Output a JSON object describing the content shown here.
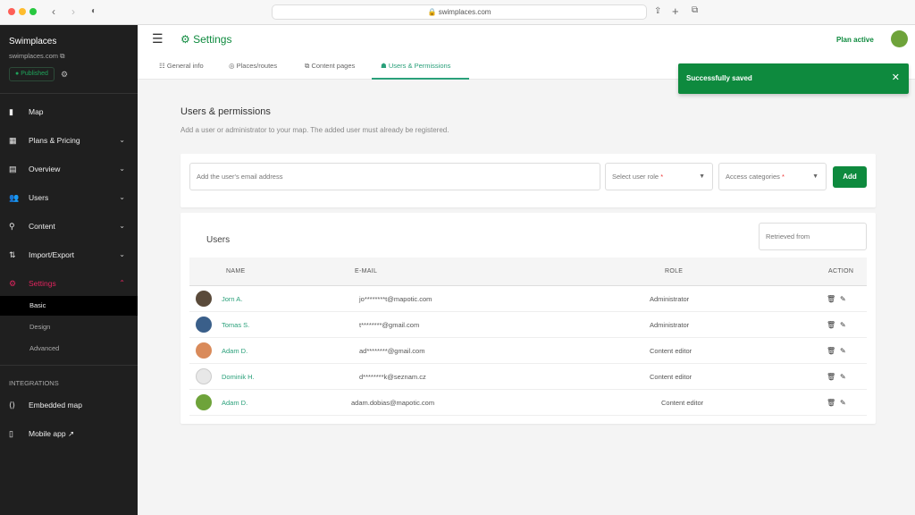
{
  "browser": {
    "url": "swimplaces.com"
  },
  "sidebar": {
    "project_name": "Swimplaces",
    "domain": "swimplaces.com",
    "status": "Published",
    "items": [
      {
        "label": "Map",
        "icon": "map-icon"
      },
      {
        "label": "Plans & Pricing",
        "icon": "grid-icon",
        "chevron": "down"
      },
      {
        "label": "Overview",
        "icon": "chart-icon",
        "chevron": "down"
      },
      {
        "label": "Users",
        "icon": "users-icon",
        "chevron": "down"
      },
      {
        "label": "Content",
        "icon": "pin-icon",
        "chevron": "down"
      },
      {
        "label": "Import/Export",
        "icon": "import-export-icon",
        "chevron": "down"
      },
      {
        "label": "Settings",
        "icon": "gear-icon",
        "chevron": "up",
        "active": true
      }
    ],
    "settings_sub": [
      "Basic",
      "Design",
      "Advanced"
    ],
    "integrations_heading": "INTEGRATIONS",
    "integrations": [
      {
        "label": "Embedded map",
        "icon": "embed-icon"
      },
      {
        "label": "Mobile app",
        "icon": "mobile-icon"
      }
    ]
  },
  "header": {
    "title": "Settings",
    "plan": "Plan active"
  },
  "tabs": [
    {
      "label": "General info",
      "icon": "sliders-icon"
    },
    {
      "label": "Places/routes",
      "icon": "pin-icon"
    },
    {
      "label": "Content pages",
      "icon": "copy-icon"
    },
    {
      "label": "Users & Permissions",
      "icon": "user-lock-icon",
      "active": true
    }
  ],
  "toast": {
    "message": "Successfully saved"
  },
  "section": {
    "title": "Users & permissions",
    "description": "Add a user or administrator to your map. The added user must already be registered."
  },
  "form": {
    "email_placeholder": "Add the user's email address",
    "role_placeholder": "Select user role",
    "categories_placeholder": "Access categories",
    "required_mark": "*",
    "add_label": "Add"
  },
  "users": {
    "title": "Users",
    "retrieved_placeholder": "Retrieved from",
    "columns": [
      "NAME",
      "E-MAIL",
      "ROLE",
      "ACTION"
    ],
    "rows": [
      {
        "name": "Jorn A.",
        "email": "jo********t@mapotic.com",
        "role": "Administrator"
      },
      {
        "name": "Tomas S.",
        "email": "t********@gmail.com",
        "role": "Administrator"
      },
      {
        "name": "Adam D.",
        "email": "ad********@gmail.com",
        "role": "Content editor"
      },
      {
        "name": "Dominik H.",
        "email": "d********k@seznam.cz",
        "role": "Content editor"
      },
      {
        "name": "Adam D.",
        "email": "adam.dobias@mapotic.com",
        "role": "Content editor"
      }
    ]
  },
  "colors": {
    "accent": "#0e8a3e",
    "link": "#2aa07a",
    "settings_active": "#e0245e",
    "sidebar_bg": "#1f1f1f"
  }
}
